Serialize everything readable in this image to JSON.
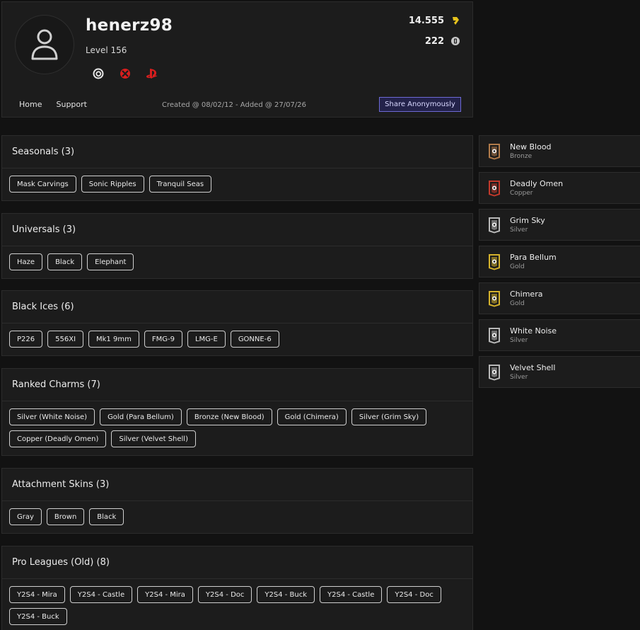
{
  "profile": {
    "username": "henerz98",
    "level": "Level 156",
    "credits": "14.555",
    "renown": "222",
    "created": "Created @ 08/02/12 - Added @ 27/07/26",
    "share_label": "Share Anonymously",
    "nav": [
      "Home",
      "Support"
    ],
    "platform_icons": [
      "ubisoft-icon",
      "xbox-icon",
      "playstation-icon"
    ]
  },
  "sections": [
    {
      "title": "Seasonals (3)",
      "items": [
        "Mask Carvings",
        "Sonic Ripples",
        "Tranquil Seas"
      ]
    },
    {
      "title": "Universals (3)",
      "items": [
        "Haze",
        "Black",
        "Elephant"
      ]
    },
    {
      "title": "Black Ices (6)",
      "items": [
        "P226",
        "556XI",
        "Mk1 9mm",
        "FMG-9",
        "LMG-E",
        "GONNE-6"
      ]
    },
    {
      "title": "Ranked Charms (7)",
      "items": [
        "Silver (White Noise)",
        "Gold (Para Bellum)",
        "Bronze (New Blood)",
        "Gold (Chimera)",
        "Silver (Grim Sky)",
        "Copper (Deadly Omen)",
        "Silver (Velvet Shell)"
      ]
    },
    {
      "title": "Attachment Skins (3)",
      "items": [
        "Gray",
        "Brown",
        "Black"
      ]
    },
    {
      "title": "Pro Leagues (Old) (8)",
      "items": [
        "Y2S4 - Mira",
        "Y2S4 - Castle",
        "Y2S4 - Mira",
        "Y2S4 - Doc",
        "Y2S4 - Buck",
        "Y2S4 - Castle",
        "Y2S4 - Doc",
        "Y2S4 - Buck"
      ]
    }
  ],
  "charms": [
    {
      "name": "New Blood",
      "tier": "Bronze",
      "color": "#b07a4a"
    },
    {
      "name": "Deadly Omen",
      "tier": "Copper",
      "color": "#c0392b"
    },
    {
      "name": "Grim Sky",
      "tier": "Silver",
      "color": "#b8b8b8"
    },
    {
      "name": "Para Bellum",
      "tier": "Gold",
      "color": "#d4b12c"
    },
    {
      "name": "Chimera",
      "tier": "Gold",
      "color": "#d4b12c"
    },
    {
      "name": "White Noise",
      "tier": "Silver",
      "color": "#b8b8b8"
    },
    {
      "name": "Velvet Shell",
      "tier": "Silver",
      "color": "#b8b8b8"
    }
  ],
  "colors": {
    "accent": "#6d6ad6",
    "xbox": "#d81e1e",
    "playstation": "#d81e1e",
    "credits": "#e8c41c"
  }
}
